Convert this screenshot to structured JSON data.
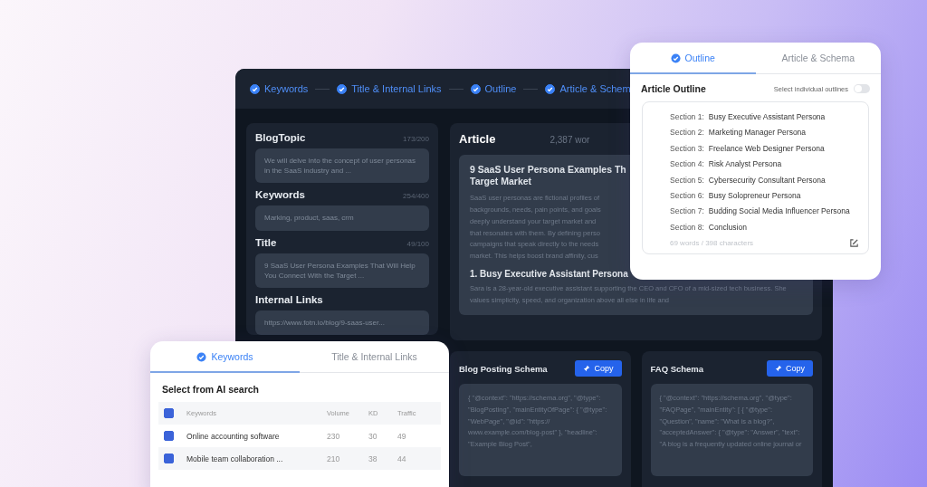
{
  "steps": [
    {
      "label": "Keywords",
      "completed": true
    },
    {
      "label": "Title & Internal Links",
      "completed": true
    },
    {
      "label": "Outline",
      "completed": true
    },
    {
      "label": "Article & Schem",
      "completed": true
    }
  ],
  "fields": [
    {
      "label": "BlogTopic",
      "count": "173/200",
      "value": "We will delve into the concept of user personas in the SaaS industry and ..."
    },
    {
      "label": "Keywords",
      "count": "254/400",
      "value": "Marking, product, saas, crm"
    },
    {
      "label": "Title",
      "count": "49/100",
      "value": "9 SaaS User Persona Examples That Will Help You Connect With the Target ..."
    },
    {
      "label": "Internal Links",
      "value": "https://www.fotn.io/blog/9-saas-user..."
    }
  ],
  "article": {
    "title": "Article",
    "word_count": "2,387 wor",
    "heading_lines": [
      "9 SaaS User Persona Examples Th",
      "Target Market"
    ],
    "intro_lines": [
      "SaaS user personas are fictional profiles of",
      "backgrounds, needs, pain points, and goals",
      "deeply understand your target market and",
      "that resonates with them. By defining perso",
      "campaigns that speak directly to the needs",
      "market. This helps boost brand affinity, cus"
    ],
    "section_heading": "1. Busy Executive Assistant Persona",
    "section_text": "Sara is a 28-year-old executive assistant supporting the CEO and CFO of a mid-sized tech business. She values simplicity, speed, and organization above all else in life and"
  },
  "schemas": [
    {
      "title": "Blog Posting Schema",
      "button": "Copy",
      "code": "{ \"@context\": \"https://schema.org\", \"@type\": \"BlogPosting\", \"mainEntityOfPage\": { \"@type\": \"WebPage\", \"@id\": \"https:// www.example.com/blog-post\" }, \"headline\": \"Example Blog Post\","
    },
    {
      "title": "FAQ Schema",
      "button": "Copy",
      "code": "{ \"@context\": \"https://schema.org\", \"@type\": \"FAQPage\", \"mainEntity\": [ { \"@type\": \"Question\", \"name\": \"What is a blog?\", \"acceptedAnswer\": { \"@type\": \"Answer\", \"text\": \"A blog is a frequently updated online journal or"
    }
  ],
  "outline_card": {
    "tabs": [
      {
        "label": "Outline",
        "selected": true
      },
      {
        "label": "Article & Schema",
        "selected": false
      }
    ],
    "title": "Article Outline",
    "toggle_label": "Select individual outlines",
    "toggle_on": false,
    "sections": [
      {
        "label": "Section 1:",
        "title": "Busy Executive Assistant Persona"
      },
      {
        "label": "Section 2:",
        "title": "Marketing Manager Persona"
      },
      {
        "label": "Section 3:",
        "title": "Freelance Web Designer Persona"
      },
      {
        "label": "Section 4:",
        "title": "Risk Analyst Persona"
      },
      {
        "label": "Section 5:",
        "title": "Cybersecurity Consultant Persona"
      },
      {
        "label": "Section 6:",
        "title": "Busy Solopreneur Persona"
      },
      {
        "label": "Section 7:",
        "title": "Budding Social Media Influencer Persona"
      },
      {
        "label": "Section 8:",
        "title": "Conclusion"
      }
    ],
    "footer": "69 words / 398 characters"
  },
  "keywords_card": {
    "tabs": [
      {
        "label": "Keywords",
        "selected": true
      },
      {
        "label": "Title & Internal Links",
        "selected": false
      }
    ],
    "title": "Select from AI search",
    "columns": [
      "Keywords",
      "Volume",
      "KD",
      "Traffic"
    ],
    "all_checked": true,
    "rows": [
      {
        "keyword": "Online accounting software",
        "volume": "230",
        "kd": "30",
        "traffic": "49",
        "checked": true
      },
      {
        "keyword": "Mobile team collaboration ...",
        "volume": "210",
        "kd": "38",
        "traffic": "44",
        "checked": true
      }
    ]
  }
}
